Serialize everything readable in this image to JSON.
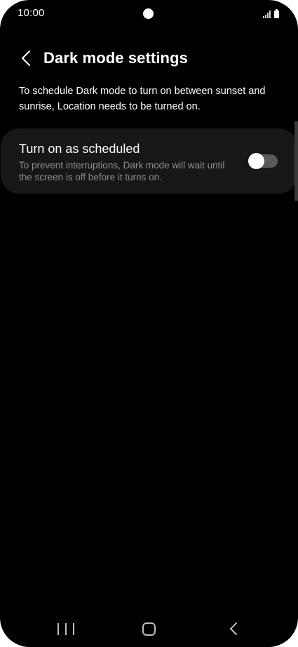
{
  "status_bar": {
    "time": "10:00"
  },
  "header": {
    "title": "Dark mode settings",
    "back_icon": "chevron-left-icon"
  },
  "description": "To schedule Dark mode to turn on between sunset and sunrise, Location needs to be turned on.",
  "setting": {
    "title": "Turn on as scheduled",
    "description": "To prevent interruptions, Dark mode will wait until the screen is off before it turns on.",
    "toggle_on": false
  },
  "colors": {
    "background": "#000000",
    "card": "#171717",
    "secondary_text": "#8f8f8f",
    "toggle_track_off": "#5a5a5a"
  },
  "nav_bar": {
    "recents_icon": "recents-icon",
    "home_icon": "home-icon",
    "back_icon": "back-icon"
  }
}
